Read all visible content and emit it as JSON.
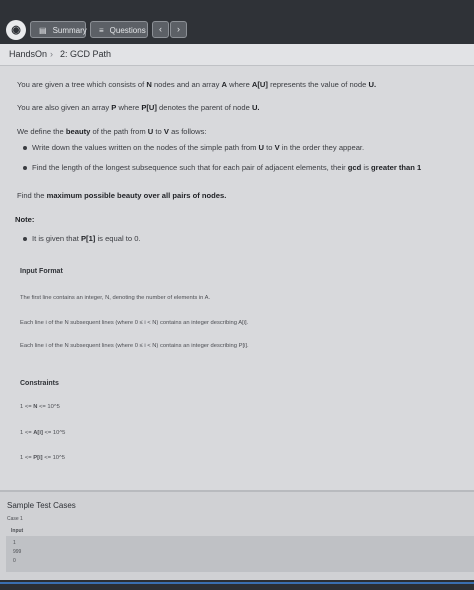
{
  "toolbar": {
    "logo_glyph": "◉",
    "summary_label": "Summary",
    "summary_icon": "document-icon",
    "questions_label": "Questions",
    "questions_icon": "list-icon",
    "prev_glyph": "‹",
    "next_glyph": "›"
  },
  "breadcrumb": {
    "root": "HandsOn",
    "separator": "›",
    "current": "2: GCD Path"
  },
  "problem": {
    "p1_a": "You are given a tree which consists of",
    "p1_b": "N",
    "p1_c": "nodes and an array",
    "p1_d": "A",
    "p1_e": "where",
    "p1_f": "A[U]",
    "p1_g": "represents the value of node",
    "p1_h": "U.",
    "p2_a": "You are also given an array",
    "p2_b": "P",
    "p2_c": "where",
    "p2_d": "P[U]",
    "p2_e": "denotes the parent of node",
    "p2_f": "U.",
    "p3_a": "We define the",
    "p3_b": "beauty",
    "p3_c": "of the path from",
    "p3_d": "U",
    "p3_e": "to",
    "p3_f": "V",
    "p3_g": "as follows:",
    "b1_a": "Write down the values written on the nodes of the simple path from",
    "b1_b": "U",
    "b1_c": "to",
    "b1_d": "V",
    "b1_e": "in the order they appear.",
    "b2_a": "Find the length of the longest subsequence such that for each pair of adjacent elements, their",
    "b2_b": "gcd",
    "b2_c": "is",
    "b2_d": "greater than 1",
    "find_a": "Find the",
    "find_b": "maximum possible beauty over all pairs of nodes.",
    "note_title": "Note:",
    "note_a": "It is given that",
    "note_b": "P[1]",
    "note_c": "is equal to 0."
  },
  "input_format": {
    "title": "Input Format",
    "line1": "The first line contains an integer, N, denoting the number of elements in A.",
    "line2": "Each line i of the N subsequent lines (where 0 ≤ i < N) contains an integer describing A[i].",
    "line3": "Each line i of the N subsequent lines (where 0 ≤ i < N) contains an integer describing P[i]."
  },
  "constraints": {
    "title": "Constraints",
    "c1_a": "1 <=",
    "c1_b": "N",
    "c1_c": "<= 10^5",
    "c2_a": "1 <=",
    "c2_b": "A[i]",
    "c2_c": "<= 10^5",
    "c3_a": "1 <=",
    "c3_b": "P[i]",
    "c3_c": "<= 10^5"
  },
  "samples": {
    "title": "Sample Test Cases",
    "case_label": "Case 1",
    "input_label": "Input",
    "input_lines": [
      "1",
      "999",
      "0"
    ]
  }
}
